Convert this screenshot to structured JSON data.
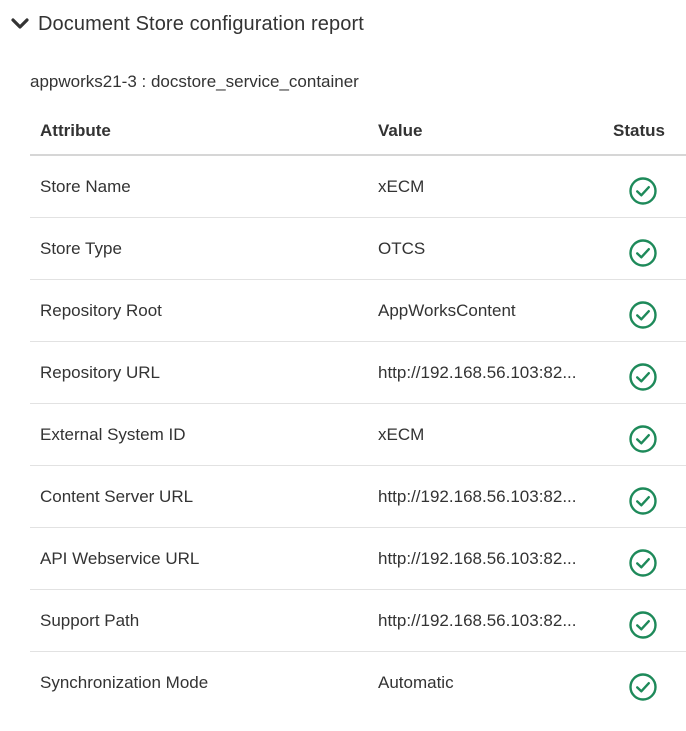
{
  "header": {
    "title": "Document Store configuration report",
    "chevron_icon": "chevron-down-icon"
  },
  "subtitle": "appworks21-3 : docstore_service_container",
  "table": {
    "columns": [
      "Attribute",
      "Value",
      "Status"
    ],
    "rows": [
      {
        "attribute": "Store Name",
        "value": "xECM",
        "status": "ok"
      },
      {
        "attribute": "Store Type",
        "value": "OTCS",
        "status": "ok"
      },
      {
        "attribute": "Repository Root",
        "value": "AppWorksContent",
        "status": "ok"
      },
      {
        "attribute": "Repository URL",
        "value": "http://192.168.56.103:82...",
        "status": "ok"
      },
      {
        "attribute": "External System ID",
        "value": "xECM",
        "status": "ok"
      },
      {
        "attribute": "Content Server URL",
        "value": "http://192.168.56.103:82...",
        "status": "ok"
      },
      {
        "attribute": "API Webservice URL",
        "value": "http://192.168.56.103:82...",
        "status": "ok"
      },
      {
        "attribute": "Support Path",
        "value": "http://192.168.56.103:82...",
        "status": "ok"
      },
      {
        "attribute": "Synchronization Mode",
        "value": "Automatic",
        "status": "ok"
      }
    ]
  },
  "colors": {
    "status_ok": "#1e8a5a",
    "text": "#333333",
    "divider": "#e2e2e2"
  }
}
